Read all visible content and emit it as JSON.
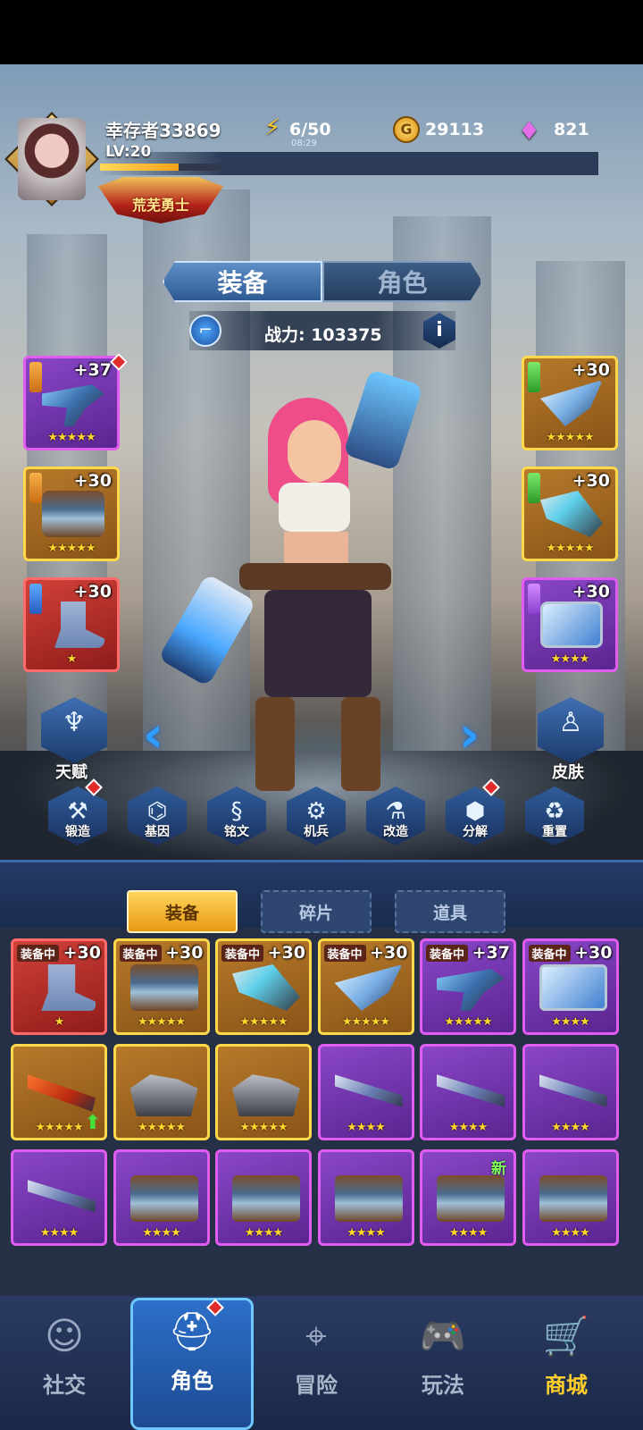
{
  "header": {
    "player_name": "幸存者33869",
    "level": "LV:20",
    "xp_fraction": 0.65,
    "title_badge": "荒芜勇士",
    "energy": "6/50",
    "energy_timer": "08:29",
    "gold": "29113",
    "gems": "821"
  },
  "tabs": {
    "equip": "装备",
    "role": "角色"
  },
  "power": {
    "label": "战力: 103375"
  },
  "slots": {
    "left": [
      {
        "level": "+37",
        "stars": "★★★★★",
        "color": "purple",
        "art": "gun",
        "gem": "g"
      },
      {
        "level": "+30",
        "stars": "★★★★★",
        "color": "gold",
        "art": "armor",
        "gem": "g"
      },
      {
        "level": "+30",
        "stars": "★",
        "color": "red",
        "art": "boot",
        "gem": "b"
      }
    ],
    "right": [
      {
        "level": "+30",
        "stars": "★★★★★",
        "color": "gold",
        "art": "wing",
        "gem": "gr"
      },
      {
        "level": "+30",
        "stars": "★★★★★",
        "color": "gold",
        "art": "cannon",
        "gem": "gr"
      },
      {
        "level": "+30",
        "stars": "★★★★",
        "color": "purple",
        "art": "card",
        "gem": "p"
      }
    ]
  },
  "side_buttons": {
    "talent": "天赋",
    "skin": "皮肤"
  },
  "actions": [
    "锻造",
    "基因",
    "铭文",
    "机兵",
    "改造",
    "分解",
    "重置"
  ],
  "inventory": {
    "tabs": [
      "装备",
      "碎片",
      "道具"
    ],
    "equipped_tag": "装备中",
    "new_tag": "新",
    "rows": [
      [
        {
          "color": "red",
          "art": "boot",
          "level": "+30",
          "stars": "★",
          "equipped": true
        },
        {
          "color": "gold",
          "art": "armor",
          "level": "+30",
          "stars": "★★★★★",
          "equipped": true
        },
        {
          "color": "gold",
          "art": "cannon",
          "level": "+30",
          "stars": "★★★★★",
          "equipped": true
        },
        {
          "color": "gold",
          "art": "wing",
          "level": "+30",
          "stars": "★★★★★",
          "equipped": true
        },
        {
          "color": "purple",
          "art": "gun",
          "level": "+37",
          "stars": "★★★★★",
          "equipped": true
        },
        {
          "color": "purple",
          "art": "card",
          "level": "+30",
          "stars": "★★★★",
          "equipped": true
        }
      ],
      [
        {
          "color": "gold",
          "art": "rifle",
          "level": "",
          "stars": "★★★★★",
          "upgrade": true
        },
        {
          "color": "gold",
          "art": "beast",
          "level": "",
          "stars": "★★★★★"
        },
        {
          "color": "gold",
          "art": "beast",
          "level": "",
          "stars": "★★★★★"
        },
        {
          "color": "purple",
          "art": "shotgun",
          "level": "",
          "stars": "★★★★"
        },
        {
          "color": "purple",
          "art": "shotgun",
          "level": "",
          "stars": "★★★★"
        },
        {
          "color": "purple",
          "art": "shotgun",
          "level": "",
          "stars": "★★★★"
        }
      ],
      [
        {
          "color": "purple",
          "art": "shotgun",
          "level": "",
          "stars": "★★★★"
        },
        {
          "color": "purple",
          "art": "armor",
          "level": "",
          "stars": "★★★★"
        },
        {
          "color": "purple",
          "art": "armor",
          "level": "",
          "stars": "★★★★"
        },
        {
          "color": "purple",
          "art": "armor",
          "level": "",
          "stars": "★★★★"
        },
        {
          "color": "purple",
          "art": "armor",
          "level": "",
          "stars": "★★★★",
          "new": true
        },
        {
          "color": "purple",
          "art": "armor",
          "level": "",
          "stars": "★★★★"
        }
      ]
    ]
  },
  "nav": {
    "social": "社交",
    "role": "角色",
    "adventure": "冒险",
    "play": "玩法",
    "shop": "商城"
  },
  "colors": {
    "accent_blue": "#2f9cff",
    "gold": "#ffd94a",
    "purple": "#e05df0",
    "red": "#ff6b6b"
  }
}
